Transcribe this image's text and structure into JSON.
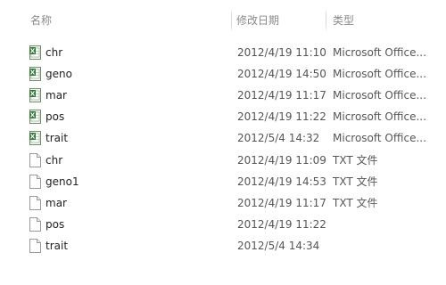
{
  "columns": {
    "name": "名称",
    "date": "修改日期",
    "type": "类型"
  },
  "files": [
    {
      "name": "chr",
      "date": "2012/4/19 11:10",
      "type": "Microsoft Office...",
      "icon": "excel-icon"
    },
    {
      "name": "geno",
      "date": "2012/4/19 14:50",
      "type": "Microsoft Office...",
      "icon": "excel-icon"
    },
    {
      "name": "mar",
      "date": "2012/4/19 11:17",
      "type": "Microsoft Office...",
      "icon": "excel-icon"
    },
    {
      "name": "pos",
      "date": "2012/4/19 11:22",
      "type": "Microsoft Office...",
      "icon": "excel-icon"
    },
    {
      "name": "trait",
      "date": "2012/5/4 14:32",
      "type": "Microsoft Office...",
      "icon": "excel-icon"
    },
    {
      "name": "chr",
      "date": "2012/4/19 11:09",
      "type": "TXT 文件",
      "icon": "text-file-icon"
    },
    {
      "name": "geno1",
      "date": "2012/4/19 14:53",
      "type": "TXT 文件",
      "icon": "text-file-icon"
    },
    {
      "name": "mar",
      "date": "2012/4/19 11:17",
      "type": "TXT 文件",
      "icon": "text-file-icon"
    },
    {
      "name": "pos",
      "date": "2012/4/19 11:22",
      "type": "",
      "icon": "text-file-icon"
    },
    {
      "name": "trait",
      "date": "2012/5/4 14:34",
      "type": "",
      "icon": "text-file-icon"
    }
  ]
}
